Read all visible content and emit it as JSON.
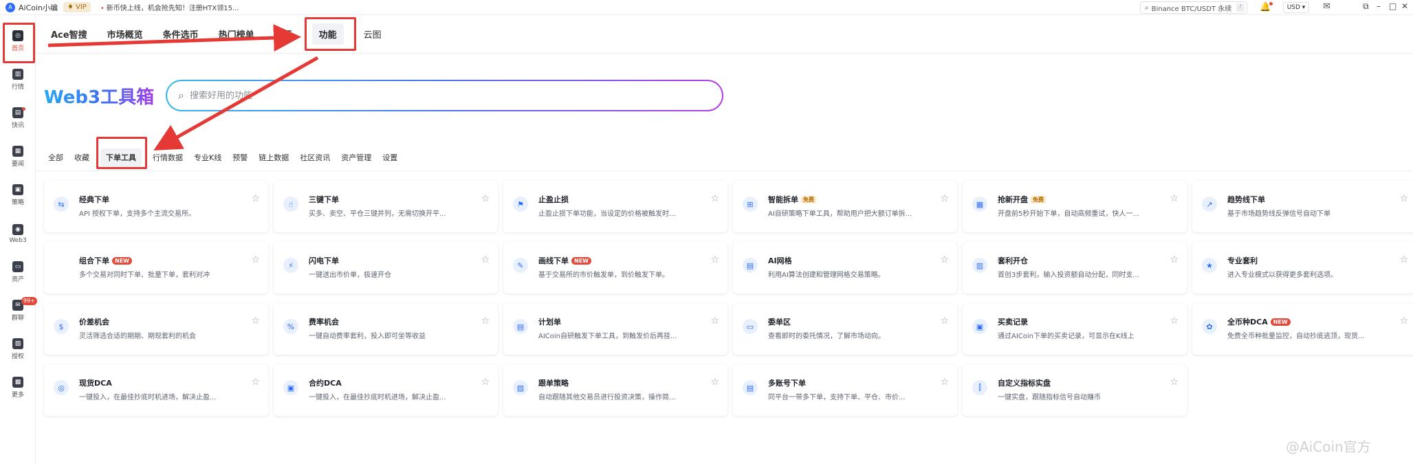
{
  "titlebar": {
    "logo_text": "A",
    "app_name": "AiCoin小编",
    "vip": "VIP",
    "news": "新币快上线，机会抢先知！注册HTX领15...",
    "search_placeholder": "Binance BTC/USDT 永续",
    "search_kbd": "/",
    "currency": "USD ▾"
  },
  "sidebar": [
    {
      "label": "首页",
      "icon": "home-icon",
      "glyph": "◎"
    },
    {
      "label": "行情",
      "icon": "market-chart-icon",
      "glyph": "▥"
    },
    {
      "label": "快讯",
      "icon": "news-flash-icon",
      "glyph": "▤"
    },
    {
      "label": "要闻",
      "icon": "headlines-icon",
      "glyph": "▦"
    },
    {
      "label": "策略",
      "icon": "strategy-robot-icon",
      "glyph": "▣"
    },
    {
      "label": "Web3",
      "icon": "web3-icon",
      "glyph": "◉"
    },
    {
      "label": "资产",
      "icon": "wallet-icon",
      "glyph": "▭"
    },
    {
      "label": "群聊",
      "icon": "chat-icon",
      "glyph": "✉"
    },
    {
      "label": "授权",
      "icon": "authorize-icon",
      "glyph": "▧"
    },
    {
      "label": "更多",
      "icon": "more-icon",
      "glyph": "▩"
    }
  ],
  "sidebar_badge": "99+",
  "topnav": {
    "tabs": [
      "Ace智搜",
      "市场概览",
      "条件选币",
      "热门榜单",
      "排行",
      "功能",
      "云图"
    ]
  },
  "hero": {
    "title": "Web3工具箱",
    "search_placeholder": "搜索好用的功能"
  },
  "categories": [
    "全部",
    "收藏",
    "下单工具",
    "行情数据",
    "专业K线",
    "预警",
    "链上数据",
    "社区资讯",
    "资产管理",
    "设置"
  ],
  "cards": [
    {
      "title": "经典下单",
      "badge": "",
      "desc": "API 授权下单，支持多个主流交易所。",
      "icon": "classic-order-icon",
      "glyph": "⇆"
    },
    {
      "title": "三键下单",
      "badge": "",
      "desc": "买多、卖空、平仓三键并列，无需切换开平...",
      "icon": "three-key-order-icon",
      "glyph": "☝"
    },
    {
      "title": "止盈止损",
      "badge": "",
      "desc": "止盈止损下单功能，当设定的价格被触发时...",
      "icon": "take-profit-stop-loss-icon",
      "glyph": "⚑"
    },
    {
      "title": "智能拆单",
      "badge": "免费",
      "desc": "AI自研策略下单工具，帮助用户把大额订单拆...",
      "icon": "smart-split-icon",
      "glyph": "⊞"
    },
    {
      "title": "抢新开盘",
      "badge": "免费",
      "desc": "开盘前5秒开始下单，自动高频重试，快人一...",
      "icon": "new-listing-icon",
      "glyph": "▦"
    },
    {
      "title": "趋势线下单",
      "badge": "",
      "desc": "基于市场趋势线反弹信号自动下单",
      "icon": "trendline-order-icon",
      "glyph": "↗"
    },
    {
      "title": "组合下单",
      "badge": "NEW",
      "desc": "多个交易对同时下单、批量下单，套利对冲",
      "icon": "combo-order-icon",
      "glyph": ""
    },
    {
      "title": "闪电下单",
      "badge": "",
      "desc": "一键送出市价单，极速开仓",
      "icon": "flash-order-icon",
      "glyph": "⚡"
    },
    {
      "title": "画线下单",
      "badge": "NEW",
      "desc": "基于交易所的市价触发单，到价触发下单。",
      "icon": "draw-line-order-icon",
      "glyph": "✎"
    },
    {
      "title": "AI网格",
      "badge": "",
      "desc": "利用AI算法创建和管理网格交易策略。",
      "icon": "ai-grid-icon",
      "glyph": "▤"
    },
    {
      "title": "套利开仓",
      "badge": "",
      "desc": "首创3步套利，输入投资额自动分配，同时支...",
      "icon": "arbitrage-open-icon",
      "glyph": "▥"
    },
    {
      "title": "专业套利",
      "badge": "",
      "desc": "进入专业模式以获得更多套利选项。",
      "icon": "pro-arbitrage-icon",
      "glyph": "★"
    },
    {
      "title": "价差机会",
      "badge": "",
      "desc": "灵活筛选合适的期期、期现套利的机会",
      "icon": "spread-opportunity-icon",
      "glyph": "$"
    },
    {
      "title": "费率机会",
      "badge": "",
      "desc": "一键自动费率套利，投入即可坐等收益",
      "icon": "funding-rate-icon",
      "glyph": "%"
    },
    {
      "title": "计划单",
      "badge": "",
      "desc": "AICoin自研触发下单工具，到触发价后再挂...",
      "icon": "plan-order-icon",
      "glyph": "▤"
    },
    {
      "title": "委单区",
      "badge": "",
      "desc": "查看即时的委托情况，了解市场动向。",
      "icon": "order-book-icon",
      "glyph": "▭"
    },
    {
      "title": "买卖记录",
      "badge": "",
      "desc": "通过AICoin下单的买卖记录，可显示在K线上",
      "icon": "trade-records-icon",
      "glyph": "▣"
    },
    {
      "title": "全币种DCA",
      "badge": "NEW",
      "desc": "免费全币种批量监控，自动抄底逃顶，现货...",
      "icon": "all-coin-dca-icon",
      "glyph": "✿"
    },
    {
      "title": "现货DCA",
      "badge": "",
      "desc": "一键投入，在最佳抄底时机进场，解决止盈...",
      "icon": "spot-dca-icon",
      "glyph": "◎"
    },
    {
      "title": "合约DCA",
      "badge": "",
      "desc": "一键投入，在最佳抄底时机进场，解决止盈...",
      "icon": "futures-dca-icon",
      "glyph": "▣"
    },
    {
      "title": "跟单策略",
      "badge": "",
      "desc": "自动跟随其他交易员进行投资决策，操作简...",
      "icon": "copy-trading-icon",
      "glyph": "▧"
    },
    {
      "title": "多账号下单",
      "badge": "",
      "desc": "同平台一带多下单，支持下单、平仓、市价...",
      "icon": "multi-account-order-icon",
      "glyph": "▤"
    },
    {
      "title": "自定义指标实盘",
      "badge": "",
      "desc": "一键实盘，跟随指标信号自动赚币",
      "icon": "custom-indicator-icon",
      "glyph": "⫿"
    }
  ],
  "watermark": "@AiCoin官方",
  "colors": {
    "highlight_red": "#e53935",
    "accent_blue": "#2d6cf6",
    "badge_red": "#e24b3b"
  }
}
